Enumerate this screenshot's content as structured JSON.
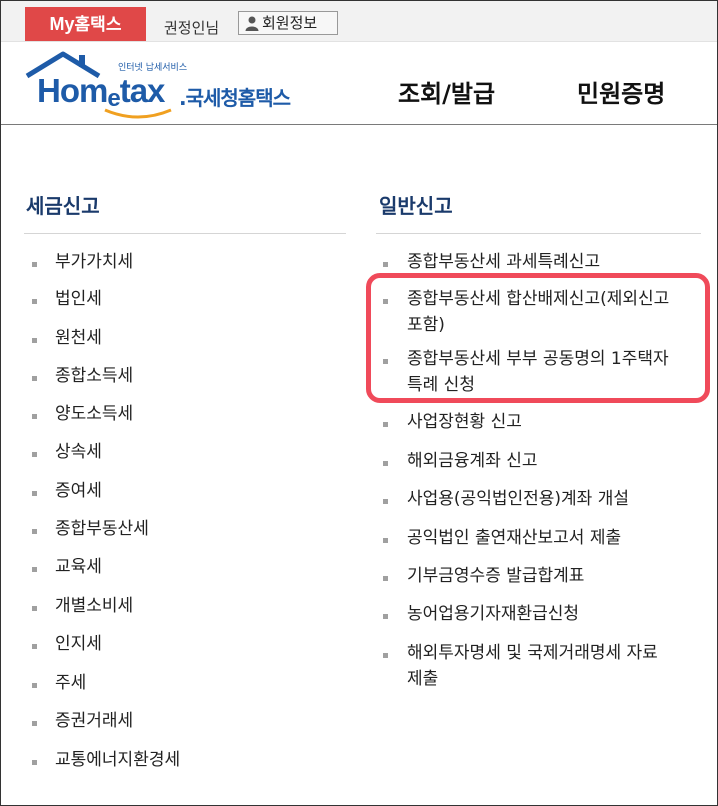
{
  "topbar": {
    "myhome_prefix": "My",
    "myhome_suffix": "홈택스",
    "username": "권정인님",
    "member_button": "회원정보"
  },
  "header": {
    "logo_tagline": "인터넷 납세서비스",
    "logo_word_a": "Hom",
    "logo_word_e": "e",
    "logo_word_b": "tax",
    "logo_korean": ".국세청홈택스",
    "nav": [
      "조회/발급",
      "민원증명"
    ]
  },
  "left": {
    "title": "세금신고",
    "items": [
      "부가가치세",
      "법인세",
      "원천세",
      "종합소득세",
      "양도소득세",
      "상속세",
      "증여세",
      "종합부동산세",
      "교육세",
      "개별소비세",
      "인지세",
      "주세",
      "증권거래세",
      "교통에너지환경세"
    ]
  },
  "right": {
    "title": "일반신고",
    "items": [
      {
        "l1": "종합부동산세 과세특례신고",
        "l2": ""
      },
      {
        "l1": "종합부동산세 합산배제신고(제외신고",
        "l2": "포함)"
      },
      {
        "l1": "종합부동산세 부부 공동명의 1주택자",
        "l2": "특례 신청"
      },
      {
        "l1": "사업장현황 신고",
        "l2": ""
      },
      {
        "l1": "해외금융계좌 신고",
        "l2": ""
      },
      {
        "l1": "사업용(공익법인전용)계좌 개설",
        "l2": ""
      },
      {
        "l1": "공익법인 출연재산보고서 제출",
        "l2": ""
      },
      {
        "l1": "기부금영수증 발급합계표",
        "l2": ""
      },
      {
        "l1": "농어업용기자재환급신청",
        "l2": ""
      },
      {
        "l1": "해외투자명세 및 국제거래명세 자료",
        "l2": "제출"
      }
    ]
  },
  "colors": {
    "accent_red": "#e04848",
    "highlight": "#f04a5a",
    "brand_blue": "#1e5ba8"
  }
}
